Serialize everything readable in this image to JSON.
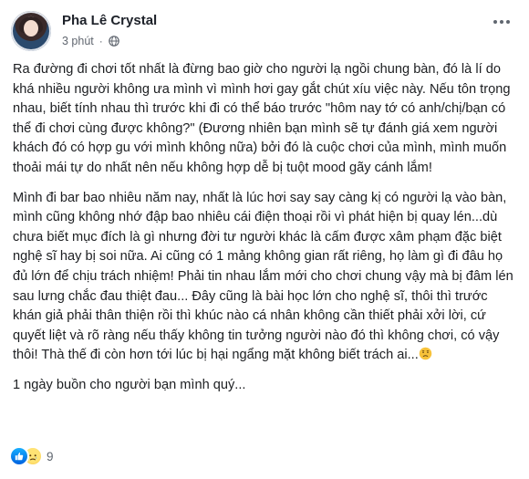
{
  "post": {
    "author": "Pha Lê Crystal",
    "time": "3 phút",
    "separator": "·",
    "paragraphs": [
      "Ra đường đi chơi tốt nhất là đừng bao giờ cho người lạ ngồi chung bàn, đó là lí do khá nhiều người không ưa mình vì mình hơi gay gắt chút xíu việc này. Nếu tôn trọng nhau, biết tính nhau thì trước khi đi có thể báo trước \"hôm nay tớ có anh/chị/bạn có thể đi chơi cùng được không?\" (Đương nhiên bạn mình sẽ tự đánh giá xem người khách đó có hợp gu với mình không nữa) bởi đó là cuộc chơi của mình, mình muốn thoải mái tự do nhất nên nếu không hợp dễ bị tuột mood gãy cánh lắm!",
      "Mình đi bar bao nhiêu năm nay, nhất là lúc hơi say say càng kị có người lạ vào bàn, mình cũng không nhớ đập bao nhiêu cái điện thoại rồi vì phát hiện bị quay lén...dù chưa biết mục đích là gì nhưng đời tư người khác là cấm được xâm phạm đặc biệt nghệ sĩ hay bị soi nữa. Ai cũng có 1 mảng không gian rất riêng, họ làm gì đi đâu họ đủ lớn để chịu trách nhiệm! Phải tin nhau lắm mới cho chơi chung vậy mà bị đâm lén sau lưng chắc đau thiệt đau... Đây cũng là bài học lớn cho nghệ sĩ, thôi thì trước khán giả phải thân thiện rồi thì khúc nào cá nhân không cần thiết phải xởi lời, cứ quyết liệt và rõ ràng nếu thấy không tin tưởng người nào đó thì không chơi, có vậy thôi! Thà thế đi còn hơn tới lúc bị hại ngẩng mặt không biết trách ai...",
      "1 ngày buồn cho người bạn mình quý..."
    ],
    "reaction_count": "9",
    "icons": {
      "privacy": "globe-icon",
      "more": "more-options-icon",
      "reactions": [
        "like-icon",
        "sad-icon"
      ],
      "inline_emoji": "disappointed-face-icon"
    },
    "colors": {
      "like": "#1877f2",
      "sad": "#f7c23a",
      "text": "#1c1e21",
      "meta": "#616770"
    }
  }
}
